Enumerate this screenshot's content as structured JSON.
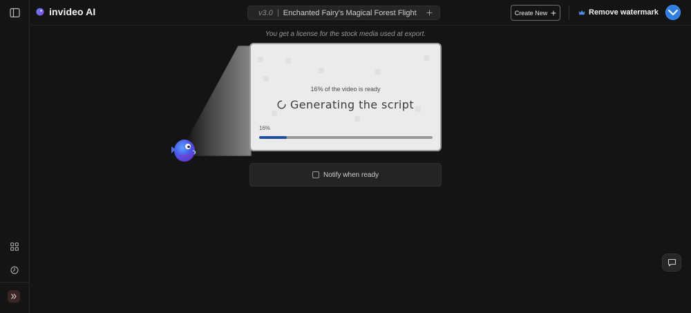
{
  "brand": {
    "name": "invideo AI"
  },
  "project": {
    "version": "v3.0",
    "title": "Enchanted Fairy's Magical Forest Flight"
  },
  "header": {
    "create_new_label": "Create New",
    "remove_watermark_label": "Remove watermark"
  },
  "main": {
    "license_note": "You get a license for the stock media used at export.",
    "ready_text": "16% of the video is ready",
    "status_text": "Generating the script",
    "progress_label": "16%",
    "progress": 0.16,
    "notify_label": "Notify when ready"
  },
  "icons": {
    "sidebar_toggle": "sidebar-panel-icon",
    "grid": "grid-icon",
    "history": "clock-icon",
    "expand": "chevrons-right-icon",
    "add": "plus-icon",
    "crown": "crown-icon",
    "chat": "chat-bubble-icon"
  },
  "colors": {
    "accent": "#1f4fa0",
    "crown": "#4a8fe8",
    "avatar": "#2d7de3"
  }
}
